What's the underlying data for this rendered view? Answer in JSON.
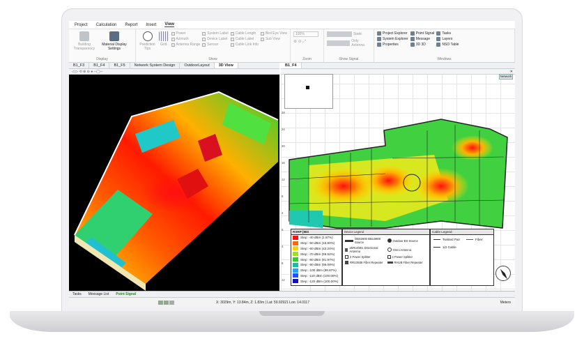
{
  "menu": [
    "Project",
    "Calculation",
    "Report",
    "Insert",
    "View"
  ],
  "ribbon": {
    "display": {
      "label": "Display",
      "building_transparency": "Building Transparency",
      "material_display": "Material Display Settings"
    },
    "show": {
      "label": "Show",
      "prediction_tips": "Prediction Tips",
      "grid": "Grid",
      "col1": [
        "Power",
        "Azimuth",
        "Antenna Range"
      ],
      "col2": [
        "System Label",
        "Device Label",
        "Sensor"
      ],
      "col3": [
        "Cable Length",
        "Cable Label",
        "Cable Link Info"
      ],
      "col4": [
        "Bird Eye View",
        "Sub View"
      ]
    },
    "zoom": {
      "label": "Zoom",
      "value": "100%"
    },
    "show_signal": {
      "label": "Show Signal",
      "static": "Static",
      "only_antenna": "Only Antenna"
    },
    "windows": {
      "label": "Windows",
      "col1": [
        "Project Explorer",
        "System Explorer",
        "Properties"
      ],
      "col2": [
        "Point Signal",
        "Message",
        "3D 3D"
      ],
      "col3": [
        "Tasks",
        "Layers",
        "NSO Table"
      ]
    }
  },
  "tabs": [
    "B1_F3",
    "B1_F4",
    "B1_F5",
    "Network System Design",
    "OutdoorLayout",
    "3D View"
  ],
  "right_tab": "B1_F4",
  "network_badge": "Network",
  "ruler": [
    "28",
    "24",
    "20",
    "16",
    "12",
    "8",
    "4",
    "0",
    "4",
    "8",
    "12"
  ],
  "signal_legend": {
    "title": "RSRP [IBS",
    "rows": [
      {
        "label": "Step: -40 dBm (1.87%)",
        "color": "#ff1010"
      },
      {
        "label": "Step: -50 dBm (15.80%)",
        "color": "#ff6a00"
      },
      {
        "label": "Step: -60 dBm (42.24%)",
        "color": "#ffd200"
      },
      {
        "label": "Step: -70 dBm (59.52%)",
        "color": "#a0e020"
      },
      {
        "label": "Step: -80 dBm (81.97%)",
        "color": "#2ed12e"
      },
      {
        "label": "Step: -90 dBm (95.00%)",
        "color": "#10c0a0"
      },
      {
        "label": "Step: -100 dBm (99.87%)",
        "color": "#20a8ff"
      },
      {
        "label": "Step: -110 dBm (100.00%)",
        "color": "#2050ff"
      },
      {
        "label": "Step: -120 dBm (100.00%)",
        "color": "#1010c0"
      }
    ]
  },
  "device_legend": {
    "title": "Device Legend",
    "items": [
      "OBS2600 BBU3900 Source",
      "Outdoor BS Source",
      "ahRU4801 Directional Antenna",
      "Omni Antenna",
      "2 Power Splitter",
      "2 Power Splitter",
      "RRU3936 Fiber Repeater",
      "RHUB Fiber Repeater"
    ]
  },
  "cable_legend": {
    "title": "Cable Legend",
    "items": [
      "Twisted Pair",
      "Fiber",
      "1/2 Cable"
    ]
  },
  "bottom_tabs": [
    "Tasks",
    "Message List",
    "Point Signal"
  ],
  "status": {
    "coords": "X: 3029m, Y: 13.84m, Z: 1.83m | Lat: 59.92921 Lon: 14.0117",
    "units": "Meters"
  },
  "colors": {
    "accent": "#2d7d2d",
    "heat_red": "#ff1010",
    "heat_yellow": "#ffd200",
    "heat_green": "#2ed12e",
    "heat_cyan": "#10c0e0"
  }
}
